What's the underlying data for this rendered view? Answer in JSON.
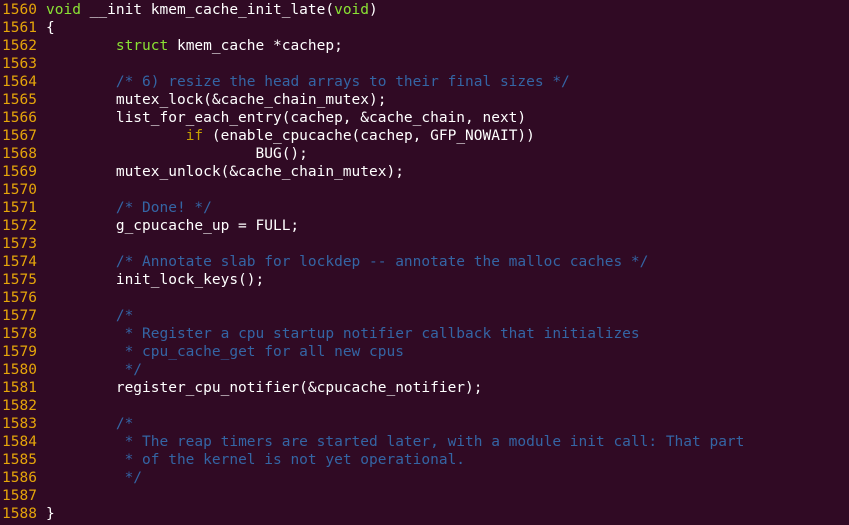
{
  "colors": {
    "background": "#300a24",
    "line_number": "#e5a50a",
    "text": "#ffffff",
    "type": "#8ae234",
    "keyword": "#c4a000",
    "comment": "#3465a4"
  },
  "lines": [
    {
      "num": "1560",
      "segments": [
        {
          "t": "type",
          "s": "void"
        },
        {
          "t": "plain",
          "s": " __init kmem_cache_init_late("
        },
        {
          "t": "type",
          "s": "void"
        },
        {
          "t": "plain",
          "s": ")"
        }
      ]
    },
    {
      "num": "1561",
      "segments": [
        {
          "t": "plain",
          "s": "{"
        }
      ]
    },
    {
      "num": "1562",
      "segments": [
        {
          "t": "plain",
          "s": "        "
        },
        {
          "t": "type",
          "s": "struct"
        },
        {
          "t": "plain",
          "s": " kmem_cache *cachep;"
        }
      ]
    },
    {
      "num": "1563",
      "segments": []
    },
    {
      "num": "1564",
      "segments": [
        {
          "t": "plain",
          "s": "        "
        },
        {
          "t": "comment",
          "s": "/* 6) resize the head arrays to their final sizes */"
        }
      ]
    },
    {
      "num": "1565",
      "segments": [
        {
          "t": "plain",
          "s": "        mutex_lock(&cache_chain_mutex);"
        }
      ]
    },
    {
      "num": "1566",
      "segments": [
        {
          "t": "plain",
          "s": "        list_for_each_entry(cachep, &cache_chain, next)"
        }
      ]
    },
    {
      "num": "1567",
      "segments": [
        {
          "t": "plain",
          "s": "                "
        },
        {
          "t": "kw",
          "s": "if"
        },
        {
          "t": "plain",
          "s": " (enable_cpucache(cachep, GFP_NOWAIT))"
        }
      ]
    },
    {
      "num": "1568",
      "segments": [
        {
          "t": "plain",
          "s": "                        BUG();"
        }
      ]
    },
    {
      "num": "1569",
      "segments": [
        {
          "t": "plain",
          "s": "        mutex_unlock(&cache_chain_mutex);"
        }
      ]
    },
    {
      "num": "1570",
      "segments": []
    },
    {
      "num": "1571",
      "segments": [
        {
          "t": "plain",
          "s": "        "
        },
        {
          "t": "comment",
          "s": "/* Done! */"
        }
      ]
    },
    {
      "num": "1572",
      "segments": [
        {
          "t": "plain",
          "s": "        g_cpucache_up = FULL;"
        }
      ]
    },
    {
      "num": "1573",
      "segments": []
    },
    {
      "num": "1574",
      "segments": [
        {
          "t": "plain",
          "s": "        "
        },
        {
          "t": "comment",
          "s": "/* Annotate slab for lockdep -- annotate the malloc caches */"
        }
      ]
    },
    {
      "num": "1575",
      "segments": [
        {
          "t": "plain",
          "s": "        init_lock_keys();"
        }
      ]
    },
    {
      "num": "1576",
      "segments": []
    },
    {
      "num": "1577",
      "segments": [
        {
          "t": "plain",
          "s": "        "
        },
        {
          "t": "comment",
          "s": "/*"
        }
      ]
    },
    {
      "num": "1578",
      "segments": [
        {
          "t": "plain",
          "s": "         "
        },
        {
          "t": "comment",
          "s": "* Register a cpu startup notifier callback that initializes"
        }
      ]
    },
    {
      "num": "1579",
      "segments": [
        {
          "t": "plain",
          "s": "         "
        },
        {
          "t": "comment",
          "s": "* cpu_cache_get for all new cpus"
        }
      ]
    },
    {
      "num": "1580",
      "segments": [
        {
          "t": "plain",
          "s": "         "
        },
        {
          "t": "comment",
          "s": "*/"
        }
      ]
    },
    {
      "num": "1581",
      "segments": [
        {
          "t": "plain",
          "s": "        register_cpu_notifier(&cpucache_notifier);"
        }
      ]
    },
    {
      "num": "1582",
      "segments": []
    },
    {
      "num": "1583",
      "segments": [
        {
          "t": "plain",
          "s": "        "
        },
        {
          "t": "comment",
          "s": "/*"
        }
      ]
    },
    {
      "num": "1584",
      "segments": [
        {
          "t": "plain",
          "s": "         "
        },
        {
          "t": "comment",
          "s": "* The reap timers are started later, with a module init call: That part"
        }
      ]
    },
    {
      "num": "1585",
      "segments": [
        {
          "t": "plain",
          "s": "         "
        },
        {
          "t": "comment",
          "s": "* of the kernel is not yet operational."
        }
      ]
    },
    {
      "num": "1586",
      "segments": [
        {
          "t": "plain",
          "s": "         "
        },
        {
          "t": "comment",
          "s": "*/"
        }
      ]
    },
    {
      "num": "1587",
      "segments": []
    },
    {
      "num": "1588",
      "segments": [
        {
          "t": "plain",
          "s": "}"
        }
      ]
    }
  ]
}
